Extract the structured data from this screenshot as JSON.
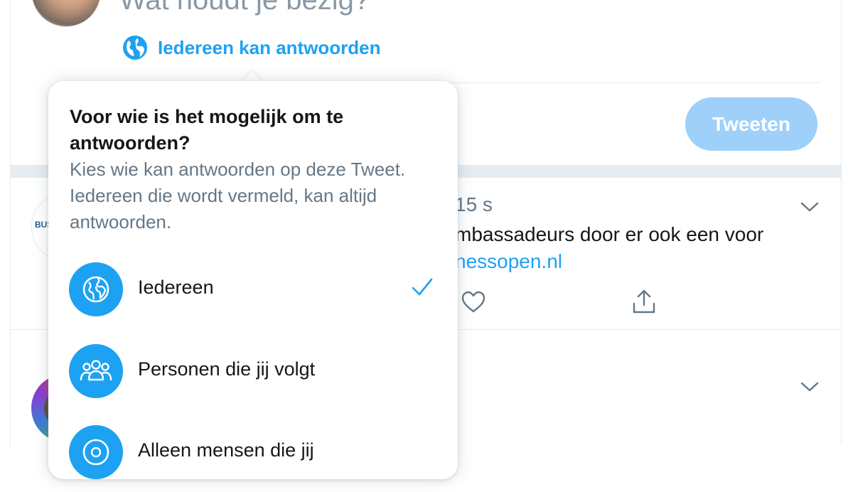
{
  "composer": {
    "placeholder": "Wat houdt je bezig?",
    "reply_setting_label": "Iedereen kan antwoorden",
    "tweet_button_label": "Tweeten"
  },
  "feed": {
    "tweet1": {
      "avatar_text": "BUS",
      "time": "15 s",
      "text": "mbassadeurs door er ook een voor",
      "link": "nessopen.nl"
    }
  },
  "popover": {
    "title": "Voor wie is het mogelijk om te antwoorden?",
    "description": "Kies wie kan antwoorden op deze Tweet. Iedereen die wordt vermeld, kan altijd antwoorden.",
    "options": [
      {
        "label": "Iedereen",
        "icon": "globe-icon",
        "selected": true
      },
      {
        "label": "Personen die jij volgt",
        "icon": "people-icon",
        "selected": false
      },
      {
        "label": "Alleen mensen die jij",
        "icon": "at-icon",
        "selected": false
      }
    ]
  },
  "colors": {
    "accent": "#1da1f2",
    "tweet_button_disabled": "#9ed0f9",
    "secondary_text": "#657786",
    "divider": "#e6ecf0"
  }
}
